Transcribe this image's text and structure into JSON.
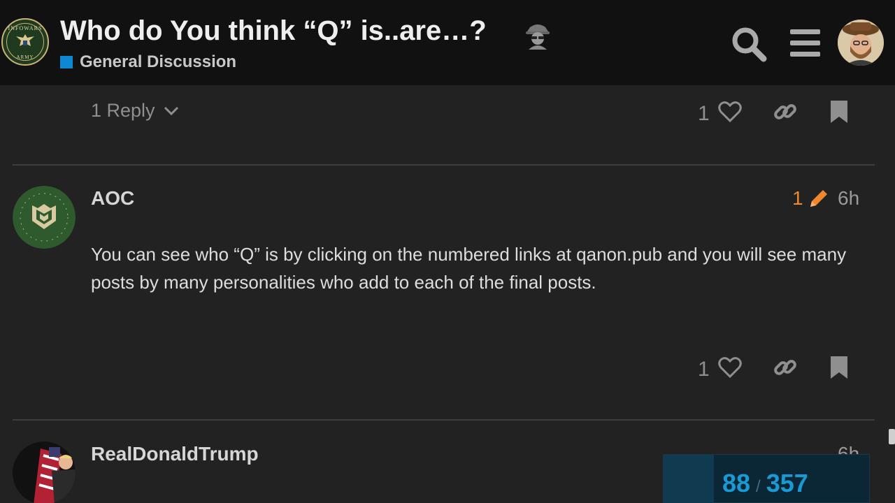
{
  "header": {
    "logo_top_text": "INFOWARS",
    "logo_bottom_text": "ARMY",
    "title": "Who do You think “Q” is..are…?",
    "title_emoji_icon": "detective-icon",
    "category_label": "General Discussion",
    "category_color": "#0e88d3",
    "icons": [
      "search-icon",
      "hamburger-menu-icon",
      "user-avatar"
    ]
  },
  "previous_post": {
    "reply_label": "1 Reply",
    "like_count": "1"
  },
  "posts": [
    {
      "username": "AOC",
      "edit_count": "1",
      "date": "6h",
      "body": "You can see who “Q” is by clicking on the numbered links at qanon.pub and you will see many posts by many personalities who add to each of the final posts.",
      "like_count": "1"
    },
    {
      "username": "RealDonaldTrump",
      "date": "6h",
      "body_visible": "..."
    }
  ],
  "timeline": {
    "current": "88",
    "separator": "/",
    "total": "357",
    "progress_fraction": 0.2465
  },
  "colors": {
    "background": "#222222",
    "header": "#111111",
    "accent_blue": "#1a9ad4",
    "edit_orange": "#f0872c"
  }
}
